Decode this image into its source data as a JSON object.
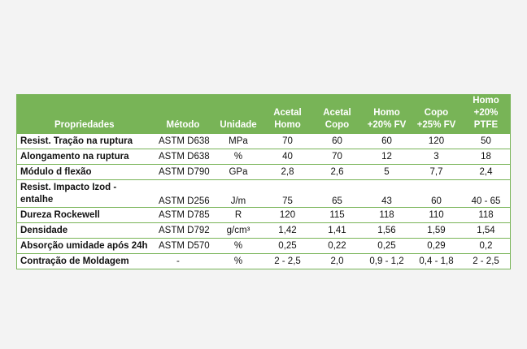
{
  "table": {
    "headers": {
      "property": "Propriedades",
      "method": "Método",
      "unit": "Unidade",
      "materials": [
        {
          "line1": "Acetal",
          "line2": "Homo"
        },
        {
          "line1": "Acetal",
          "line2": "Copo"
        },
        {
          "line1": "Homo",
          "line2": "+20% FV"
        },
        {
          "line1": "Copo",
          "line2": "+25% FV"
        },
        {
          "line1": "Homo",
          "line2": "+20% PTFE"
        }
      ]
    },
    "rows": [
      {
        "property": "Resist. Tração na ruptura",
        "method": "ASTM D638",
        "unit": "MPa",
        "values": [
          "70",
          "60",
          "60",
          "120",
          "50"
        ]
      },
      {
        "property": "Alongamento na ruptura",
        "method": "ASTM D638",
        "unit": "%",
        "values": [
          "40",
          "70",
          "12",
          "3",
          "18"
        ]
      },
      {
        "property": "Módulo d flexão",
        "method": "ASTM D790",
        "unit": "GPa",
        "values": [
          "2,8",
          "2,6",
          "5",
          "7,7",
          "2,4"
        ]
      },
      {
        "property": "Resist. Impacto Izod - entalhe",
        "method": "ASTM D256",
        "unit": "J/m",
        "values": [
          "75",
          "65",
          "43",
          "60",
          "40 - 65"
        ]
      },
      {
        "property": "Dureza Rockewell",
        "method": "ASTM D785",
        "unit": "R",
        "values": [
          "120",
          "115",
          "118",
          "110",
          "118"
        ]
      },
      {
        "property": "Densidade",
        "method": "ASTM D792",
        "unit": "g/cm³",
        "values": [
          "1,42",
          "1,41",
          "1,56",
          "1,59",
          "1,54"
        ]
      },
      {
        "property": "Absorção umidade após 24h",
        "method": "ASTM D570",
        "unit": "%",
        "values": [
          "0,25",
          "0,22",
          "0,25",
          "0,29",
          "0,2"
        ]
      },
      {
        "property": "Contração de Moldagem",
        "method": "-",
        "unit": "%",
        "values": [
          "2 - 2,5",
          "2,0",
          "0,9 - 1,2",
          "0,4 - 1,8",
          "2 - 2,5"
        ]
      }
    ]
  }
}
